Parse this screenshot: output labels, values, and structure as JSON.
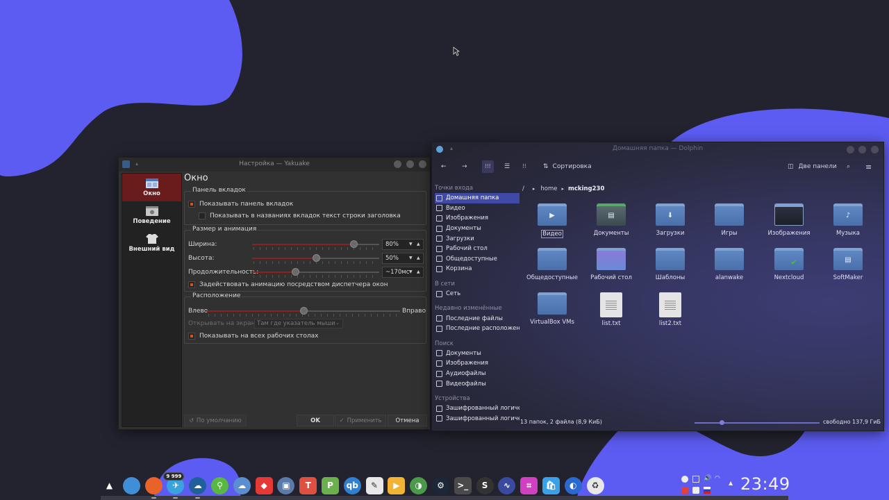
{
  "yakuake": {
    "title": "Настройка — Yakuake",
    "nav": [
      {
        "label": "Окно",
        "icon": "window-icon"
      },
      {
        "label": "Поведение",
        "icon": "behavior-icon"
      },
      {
        "label": "Внешний вид",
        "icon": "appearance-icon"
      }
    ],
    "page_title": "Окно",
    "tabs_group": {
      "title": "Панель вкладок",
      "show_tabbar": "Показывать панель вкладок",
      "show_title_in_tabs": "Показывать в названиях вкладок текст строки заголовка",
      "show_tabbar_checked": true,
      "show_title_in_tabs_checked": false
    },
    "size_group": {
      "title": "Размер и анимация",
      "width_label": "Ширина:",
      "width_value": "80%",
      "width_level": 0.8,
      "height_label": "Высота:",
      "height_value": "50%",
      "height_level": 0.5,
      "duration_label": "Продолжительность:",
      "duration_value": "~170мс",
      "duration_level": 0.34,
      "wm_animation": "Задействовать анимацию посредством диспетчера окон",
      "wm_animation_checked": true
    },
    "position_group": {
      "title": "Расположение",
      "left": "Влево",
      "right": "Вправо",
      "position_level": 0.5,
      "screen_label": "Открывать на экране:",
      "screen_value": "Там где указатель мыши",
      "all_desktops": "Показывать на всех рабочих столах",
      "all_desktops_checked": true
    },
    "buttons": {
      "defaults": "По умолчанию",
      "ok": "OK",
      "apply": "Применить",
      "cancel": "Отмена"
    }
  },
  "dolphin": {
    "title": "Домашняя папка — Dolphin",
    "toolbar": {
      "sort": "Сортировка",
      "split": "Две панели"
    },
    "places_sections": [
      {
        "title": "Точки входа",
        "items": [
          {
            "label": "Домашняя папка",
            "icon": "home-icon",
            "active": true
          },
          {
            "label": "Видео",
            "icon": "video-icon"
          },
          {
            "label": "Изображения",
            "icon": "image-icon"
          },
          {
            "label": "Документы",
            "icon": "document-icon"
          },
          {
            "label": "Загрузки",
            "icon": "download-icon"
          },
          {
            "label": "Рабочий стол",
            "icon": "desktop-icon"
          },
          {
            "label": "Общедоступные",
            "icon": "folder-icon"
          },
          {
            "label": "Корзина",
            "icon": "trash-icon"
          }
        ]
      },
      {
        "title": "В сети",
        "items": [
          {
            "label": "Сеть",
            "icon": "network-icon"
          }
        ]
      },
      {
        "title": "Недавно изменённые",
        "items": [
          {
            "label": "Последние файлы",
            "icon": "recent-files-icon"
          },
          {
            "label": "Последние расположени",
            "icon": "recent-places-icon"
          }
        ]
      },
      {
        "title": "Поиск",
        "items": [
          {
            "label": "Документы",
            "icon": "document-icon"
          },
          {
            "label": "Изображения",
            "icon": "image-icon"
          },
          {
            "label": "Аудиофайлы",
            "icon": "audio-icon"
          },
          {
            "label": "Видеофайлы",
            "icon": "video-icon"
          }
        ]
      },
      {
        "title": "Устройства",
        "items": [
          {
            "label": "Зашифрованный логиче",
            "icon": "drive-icon"
          },
          {
            "label": "Зашифрованный логиче",
            "icon": "drive-icon"
          }
        ]
      }
    ],
    "breadcrumb": {
      "sep": "/",
      "parts": [
        "home",
        "mcking230"
      ]
    },
    "files": [
      {
        "name": "Видео",
        "kind": "folder",
        "emblem": "▶",
        "selected": true
      },
      {
        "name": "Документы",
        "kind": "folder-custom",
        "emblem": "▤"
      },
      {
        "name": "Загрузки",
        "kind": "folder",
        "emblem": "⬇"
      },
      {
        "name": "Игры",
        "kind": "folder",
        "emblem": ""
      },
      {
        "name": "Изображения",
        "kind": "folder-dark",
        "emblem": ""
      },
      {
        "name": "Музыка",
        "kind": "folder",
        "emblem": "♪"
      },
      {
        "name": "Общедоступные",
        "kind": "folder",
        "emblem": ""
      },
      {
        "name": "Рабочий стол",
        "kind": "folder-desktop",
        "emblem": ""
      },
      {
        "name": "Шаблоны",
        "kind": "folder",
        "emblem": ""
      },
      {
        "name": "alanwake",
        "kind": "folder",
        "emblem": ""
      },
      {
        "name": "Nextcloud",
        "kind": "folder",
        "emblem": "✔"
      },
      {
        "name": "SoftMaker",
        "kind": "folder",
        "emblem": "▤"
      },
      {
        "name": "VirtualBox VMs",
        "kind": "folder",
        "emblem": ""
      },
      {
        "name": "list.txt",
        "kind": "text",
        "emblem": ""
      },
      {
        "name": "list2.txt",
        "kind": "text",
        "emblem": ""
      }
    ],
    "status": "13 папок, 2 файла (8,9 КиБ)",
    "free_space": "свободно 137,9 ГиБ"
  },
  "dock": {
    "items": [
      {
        "name": "app-launcher-icon",
        "glyph": "▲",
        "color": "#2b2b2b"
      },
      {
        "name": "files-icon",
        "glyph": "",
        "color": "#3f8fd8"
      },
      {
        "name": "firefox-icon",
        "glyph": "",
        "color": "#e8622a"
      },
      {
        "name": "telegram-icon",
        "glyph": "✈",
        "color": "#3aa2dc",
        "badge": "9 999"
      },
      {
        "name": "nextcloud-icon",
        "glyph": "☁",
        "color": "#1f5f9a"
      },
      {
        "name": "keepass-icon",
        "glyph": "⚲",
        "color": "#58b842"
      },
      {
        "name": "cloud-drive-icon",
        "glyph": "☁",
        "color": "#5a8ed0"
      },
      {
        "name": "anydesk-icon",
        "glyph": "◆",
        "color": "#e53935"
      },
      {
        "name": "remote-desktop-icon",
        "glyph": "▣",
        "color": "#5a7aa8"
      },
      {
        "name": "textmaker-icon",
        "glyph": "T",
        "color": "#e05040"
      },
      {
        "name": "presentations-icon",
        "glyph": "P",
        "color": "#6ab04c"
      },
      {
        "name": "qbittorrent-icon",
        "glyph": "qb",
        "color": "#2f80d0"
      },
      {
        "name": "krita-icon",
        "glyph": "✎",
        "color": "#e8e8e8"
      },
      {
        "name": "video-player-icon",
        "glyph": "▶",
        "color": "#f2b233"
      },
      {
        "name": "speedcrunch-icon",
        "glyph": "◑",
        "color": "#4a9a4a"
      },
      {
        "name": "steam-icon",
        "glyph": "⚙",
        "color": "#1c2838"
      },
      {
        "name": "terminal-icon",
        "glyph": ">_",
        "color": "#4a4a4a"
      },
      {
        "name": "skype-icon",
        "glyph": "S",
        "color": "#333333"
      },
      {
        "name": "system-monitor-icon",
        "glyph": "∿",
        "color": "#3a4aa0"
      },
      {
        "name": "screenshot-icon",
        "glyph": "⌗",
        "color": "#d040c0"
      },
      {
        "name": "store-icon",
        "glyph": "🛍",
        "color": "#3aa0e8"
      },
      {
        "name": "toggle-icon",
        "glyph": "◐",
        "color": "#2a6ad0"
      },
      {
        "name": "trash-dock-icon",
        "glyph": "♻",
        "color": "#e8e8e8"
      }
    ]
  },
  "clock": "23:49",
  "colors": {
    "wallpaper_blob": "#5c5cf2",
    "accent": "#d0561c",
    "selection": "#3f4aa6"
  }
}
